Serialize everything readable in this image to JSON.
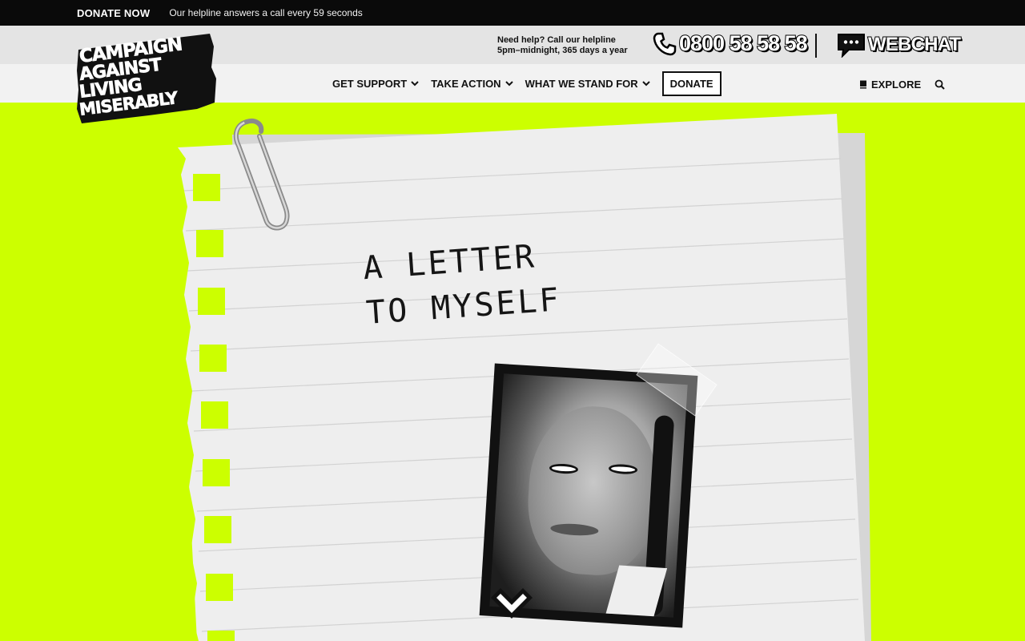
{
  "topbar": {
    "donate_label": "DONATE NOW",
    "helpline_message": "Our helpline answers a call every 59 seconds"
  },
  "contact": {
    "need_help_line1": "Need help? Call our helpline",
    "need_help_line2": "5pm–midnight, 365 days a year",
    "phone_number": "0800 58 58 58",
    "webchat_label": "WEBCHAT"
  },
  "logo": {
    "lines": [
      "CAMPAIGN",
      "AGAINST",
      "LIVING",
      "MISERABLY"
    ]
  },
  "nav": {
    "items": [
      {
        "label": "GET SUPPORT"
      },
      {
        "label": "TAKE ACTION"
      },
      {
        "label": "WHAT WE STAND FOR"
      }
    ],
    "donate_label": "DONATE",
    "explore_label": "EXPLORE"
  },
  "hero": {
    "title_line1": "A LETTER",
    "title_line2": "TO MYSELF"
  },
  "colors": {
    "accent": "#ccff00",
    "dark": "#0a0a0a",
    "paper": "#eeeeee"
  },
  "icons": [
    "phone-icon",
    "chat-icon",
    "chevron-down-icon",
    "book-icon",
    "search-icon",
    "paperclip-icon",
    "chevron-down-scroll-icon"
  ]
}
